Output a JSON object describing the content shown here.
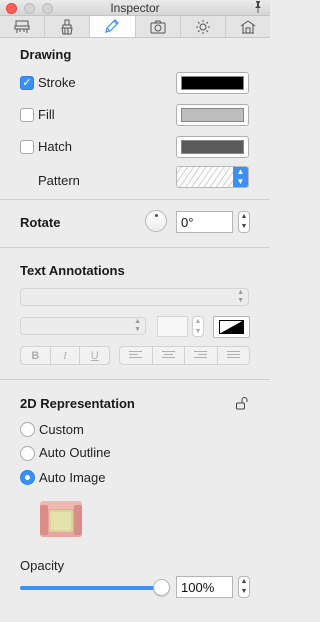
{
  "window": {
    "title": "Inspector"
  },
  "tabs": [
    {
      "icon": "furniture-icon"
    },
    {
      "icon": "brush-icon"
    },
    {
      "icon": "pencil-icon",
      "active": true
    },
    {
      "icon": "camera-icon"
    },
    {
      "icon": "sun-icon"
    },
    {
      "icon": "house-icon"
    }
  ],
  "drawing": {
    "title": "Drawing",
    "stroke": {
      "label": "Stroke",
      "checked": true,
      "color": "#000000"
    },
    "fill": {
      "label": "Fill",
      "checked": false,
      "color": "#bdbdbd"
    },
    "hatch": {
      "label": "Hatch",
      "checked": false,
      "color": "#5a5a5a"
    },
    "pattern_label": "Pattern"
  },
  "rotate": {
    "title": "Rotate",
    "value": "0°"
  },
  "text_annotations": {
    "title": "Text Annotations",
    "style_buttons": [
      "B",
      "I",
      "U"
    ]
  },
  "representation": {
    "title": "2D Representation",
    "options": [
      {
        "label": "Custom",
        "selected": false
      },
      {
        "label": "Auto Outline",
        "selected": false
      },
      {
        "label": "Auto Image",
        "selected": true
      }
    ]
  },
  "opacity": {
    "label": "Opacity",
    "value": "100%",
    "level": 1.0
  },
  "colors": {
    "accent": "#3b8ff5"
  }
}
